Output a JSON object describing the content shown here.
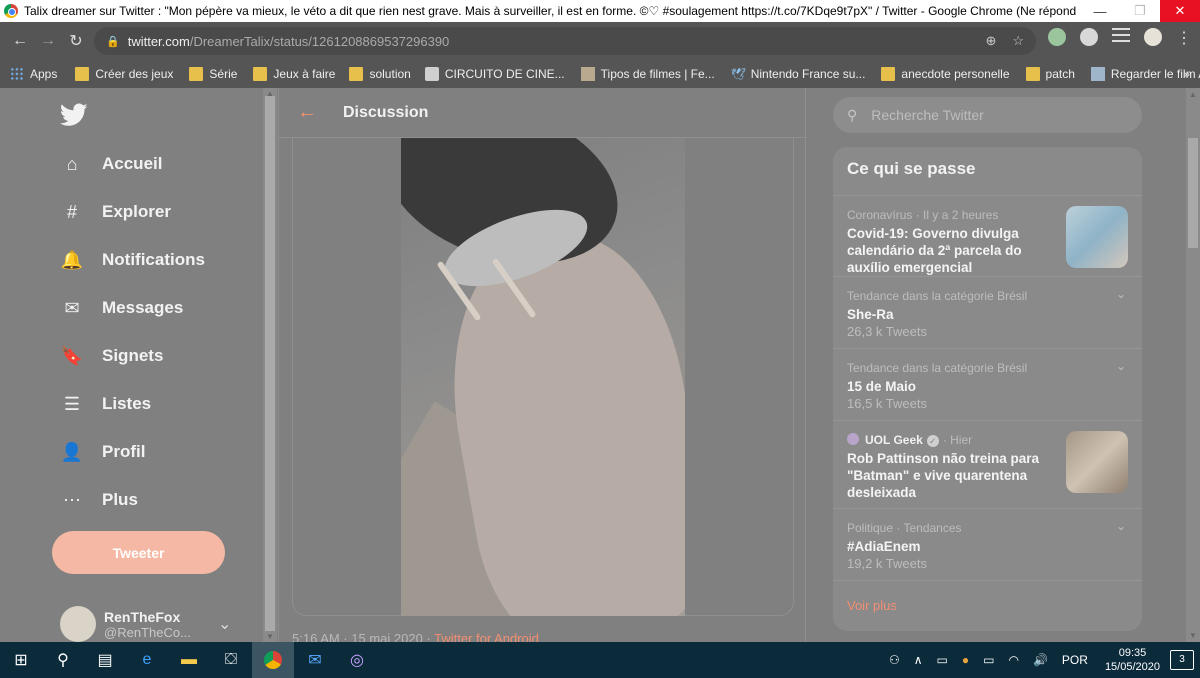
{
  "window": {
    "title": "Talix dreamer sur Twitter : \"Mon pépère va mieux, le véto a dit que rien nest grave. Mais à surveiller, il est en forme. ©♡ #soulagement https://t.co/7KDqe9t7pX\" / Twitter - Google Chrome (Ne répond pas)",
    "minimize": "—",
    "maximize": "❐",
    "close": "✕"
  },
  "browser": {
    "url_host": "twitter.com",
    "url_path": "/DreamerTalix/status/1261208869537296390",
    "back": "←",
    "forward": "→",
    "reload": "↻",
    "install_icon": "⊕",
    "star_icon": "☆",
    "menu_icon": "⋮"
  },
  "bookmarks": [
    {
      "label": "Apps",
      "icon": "grid"
    },
    {
      "label": "Créer des jeux",
      "icon": "folder"
    },
    {
      "label": "Série",
      "icon": "folder"
    },
    {
      "label": "Jeux à faire",
      "icon": "folder"
    },
    {
      "label": "solution",
      "icon": "folder"
    },
    {
      "label": "CIRCUITO DE CINE...",
      "icon": "site"
    },
    {
      "label": "Tipos de filmes | Fe...",
      "icon": "site"
    },
    {
      "label": "Nintendo France su...",
      "icon": "twitter"
    },
    {
      "label": "anecdote personelle",
      "icon": "folder"
    },
    {
      "label": "patch",
      "icon": "folder"
    },
    {
      "label": "Regarder le film Ali...",
      "icon": "site"
    }
  ],
  "bookmarks_more": "»",
  "sidebar": {
    "items": [
      {
        "label": "Accueil",
        "icon": "⌂"
      },
      {
        "label": "Explorer",
        "icon": "#"
      },
      {
        "label": "Notifications",
        "icon": "🔔"
      },
      {
        "label": "Messages",
        "icon": "✉"
      },
      {
        "label": "Signets",
        "icon": "🔖"
      },
      {
        "label": "Listes",
        "icon": "☰"
      },
      {
        "label": "Profil",
        "icon": "👤"
      },
      {
        "label": "Plus",
        "icon": "⋯"
      }
    ],
    "tweet_button": "Tweeter",
    "account": {
      "name": "RenTheFox",
      "handle": "@RenTheCo..."
    }
  },
  "header": {
    "back": "←",
    "title": "Discussion"
  },
  "tweet": {
    "time": "5:16 AM · 15 mai 2020 · ",
    "via": "Twitter for Android"
  },
  "search": {
    "placeholder": "Recherche Twitter"
  },
  "trends": {
    "title": "Ce qui se passe",
    "items": [
      {
        "context": "Coronavírus · Il y a 2 heures",
        "name": "Covid-19: Governo divulga calendário da 2ª parcela do auxílio emergencial",
        "count": ""
      },
      {
        "context": "Tendance dans la catégorie Brésil",
        "name": "She-Ra",
        "count": "26,3 k Tweets"
      },
      {
        "context": "Tendance dans la catégorie Brésil",
        "name": "15 de Maio",
        "count": "16,5 k Tweets"
      },
      {
        "context_source": "UOL Geek",
        "context_time": "· Hier",
        "name": "Rob Pattinson não treina para \"Batman\" e vive quarentena desleixada",
        "count": ""
      },
      {
        "context": "Politique · Tendances",
        "name": "#AdiaEnem",
        "count": "19,2 k Tweets"
      }
    ],
    "more": "Voir plus"
  },
  "taskbar": {
    "lang": "POR",
    "time": "09:35",
    "date": "15/05/2020",
    "notifications": "3"
  }
}
